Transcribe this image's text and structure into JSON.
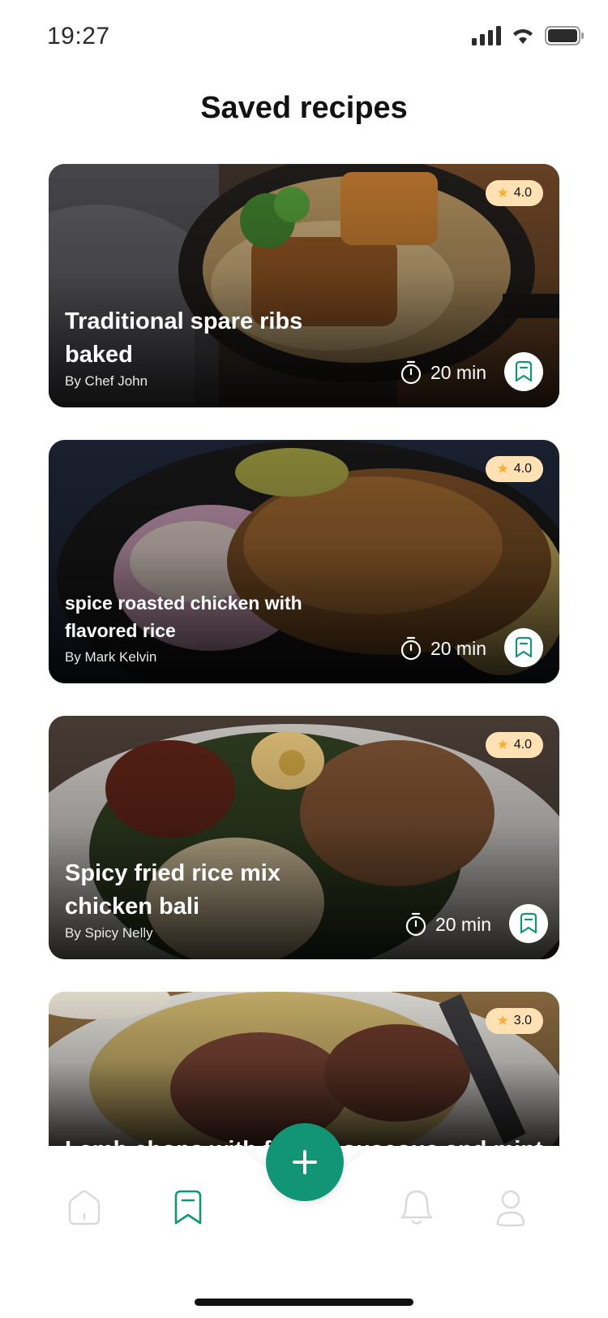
{
  "status": {
    "time": "19:27"
  },
  "page": {
    "title": "Saved recipes"
  },
  "recipes": [
    {
      "title": "Traditional spare ribs baked",
      "author": "By Chef John",
      "rating": "4.0",
      "time": "20 min"
    },
    {
      "title": "spice roasted chicken with flavored rice",
      "author": "By Mark Kelvin",
      "rating": "4.0",
      "time": "20 min"
    },
    {
      "title": "Spicy fried rice mix chicken bali",
      "author": "By Spicy Nelly",
      "rating": "4.0",
      "time": "20 min"
    },
    {
      "title": "Lamb chops with fruity couscous and mint",
      "rating": "3.0"
    }
  ],
  "nav": {
    "items": [
      "home-icon",
      "bookmark-icon",
      "bell-icon",
      "profile-icon"
    ],
    "fab_icon": "plus-icon"
  },
  "colors": {
    "accent": "#129575",
    "rating_bg": "#ffe1b3",
    "star": "#ffad30"
  }
}
